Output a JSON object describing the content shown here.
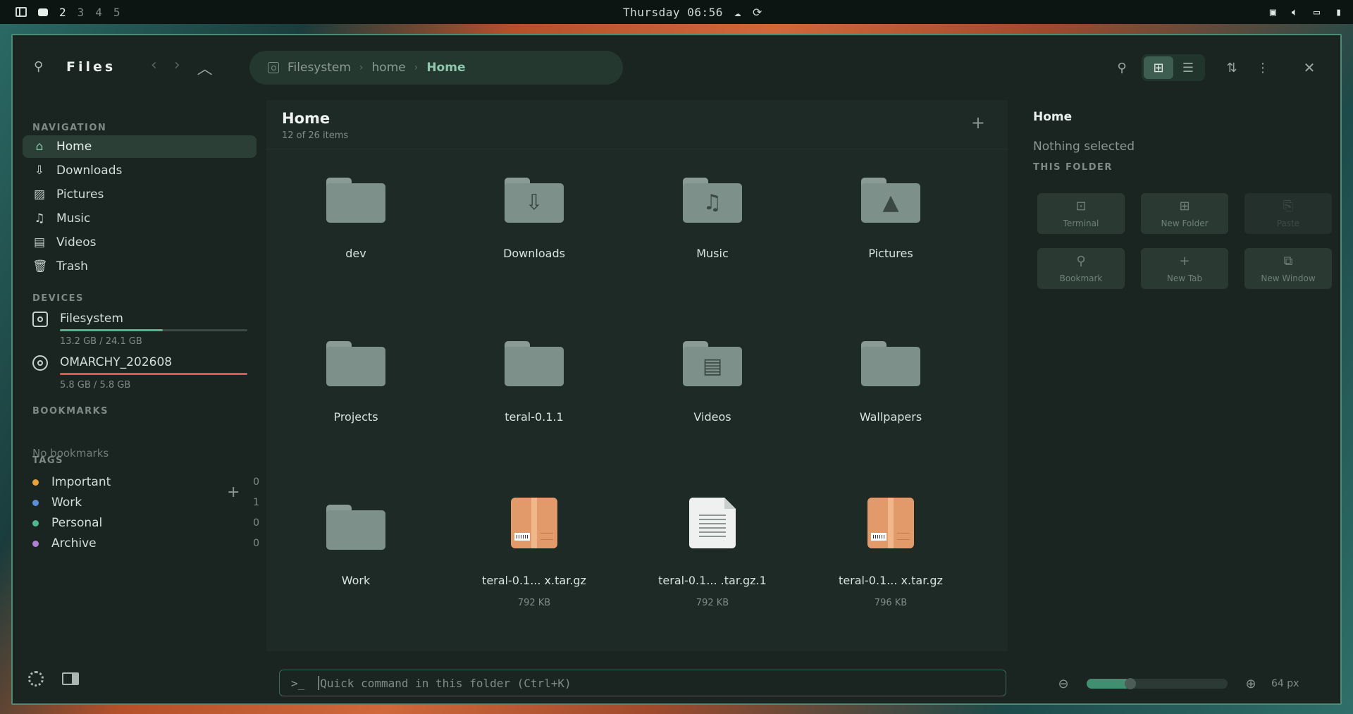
{
  "topbar": {
    "workspaces": [
      "2",
      "3",
      "4",
      "5"
    ],
    "clock": "Thursday 06:56",
    "tray_icons": [
      "network-icon",
      "volume-icon",
      "display-icon",
      "battery-icon"
    ]
  },
  "header": {
    "title": "Files",
    "breadcrumb": [
      "Filesystem",
      "home",
      "Home"
    ]
  },
  "sidebar": {
    "navigation_title": "NAVIGATION",
    "nav": [
      {
        "label": "Home",
        "icon": "home-icon",
        "active": true
      },
      {
        "label": "Downloads",
        "icon": "download-icon"
      },
      {
        "label": "Pictures",
        "icon": "image-icon"
      },
      {
        "label": "Music",
        "icon": "music-icon"
      },
      {
        "label": "Videos",
        "icon": "film-icon"
      },
      {
        "label": "Trash",
        "icon": "trash-icon"
      }
    ],
    "devices_title": "DEVICES",
    "devices": [
      {
        "name": "Filesystem",
        "size": "13.2 GB / 24.1 GB",
        "usage": 0.55,
        "color": "#4fb88e"
      },
      {
        "name": "OMARCHY_202608",
        "size": "5.8 GB / 5.8 GB",
        "usage": 1.0,
        "color": "#e0574f"
      }
    ],
    "bookmarks_title": "BOOKMARKS",
    "no_bookmarks": "No bookmarks",
    "tags_title": "TAGS",
    "tags": [
      {
        "label": "Important",
        "count": "0",
        "color": "#e6a23c"
      },
      {
        "label": "Work",
        "count": "1",
        "color": "#5b8ed6"
      },
      {
        "label": "Personal",
        "count": "0",
        "color": "#4fb88e"
      },
      {
        "label": "Archive",
        "count": "0",
        "color": "#b07fd6"
      }
    ]
  },
  "main": {
    "title": "Home",
    "subtitle": "12 of 26 items",
    "items": [
      {
        "name": "dev",
        "type": "folder",
        "glyph": ""
      },
      {
        "name": "Downloads",
        "type": "folder",
        "glyph": "⇩"
      },
      {
        "name": "Music",
        "type": "folder",
        "glyph": "♫"
      },
      {
        "name": "Pictures",
        "type": "folder",
        "glyph": "▲"
      },
      {
        "name": "Projects",
        "type": "folder",
        "glyph": ""
      },
      {
        "name": "teral-0.1.1",
        "type": "folder",
        "glyph": ""
      },
      {
        "name": "Videos",
        "type": "folder",
        "glyph": "▤"
      },
      {
        "name": "Wallpapers",
        "type": "folder",
        "glyph": ""
      },
      {
        "name": "Work",
        "type": "folder",
        "glyph": ""
      },
      {
        "name": "teral-0.1... x.tar.gz",
        "type": "archive",
        "size": "792 KB"
      },
      {
        "name": "teral-0.1... .tar.gz.1",
        "type": "text",
        "size": "792 KB"
      },
      {
        "name": "teral-0.1... x.tar.gz",
        "type": "archive",
        "size": "796 KB"
      }
    ]
  },
  "details": {
    "title": "Home",
    "nothing_selected": "Nothing selected",
    "section": "THIS FOLDER",
    "actions": [
      {
        "label": "Terminal",
        "icon": "terminal-icon",
        "glyph": "⊡"
      },
      {
        "label": "New Folder",
        "icon": "new-folder-icon",
        "glyph": "⊞"
      },
      {
        "label": "Paste",
        "icon": "paste-icon",
        "glyph": "⎘",
        "disabled": true
      },
      {
        "label": "Bookmark",
        "icon": "pin-icon",
        "glyph": "⚲"
      },
      {
        "label": "New Tab",
        "icon": "plus-icon",
        "glyph": "+"
      },
      {
        "label": "New Window",
        "icon": "new-window-icon",
        "glyph": "⧉"
      }
    ]
  },
  "footer": {
    "prompt": ">_",
    "command_placeholder": "Quick command in this folder (Ctrl+K)",
    "zoom_label": "64 px",
    "zoom_fraction": 0.27
  }
}
